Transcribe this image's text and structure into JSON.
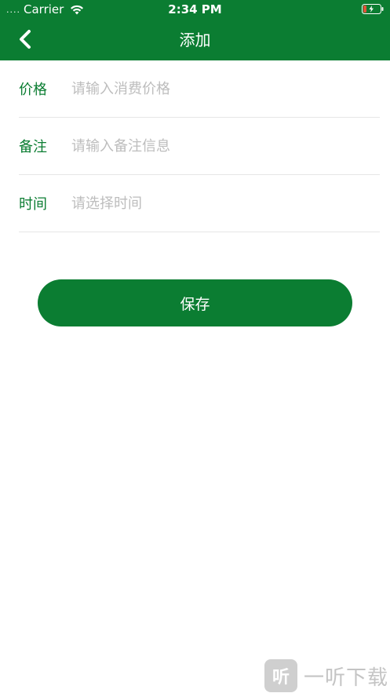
{
  "status_bar": {
    "signal": "....",
    "carrier": "Carrier",
    "time": "2:34 PM"
  },
  "nav": {
    "title": "添加",
    "back_icon": "chevron-left-icon"
  },
  "form": {
    "rows": [
      {
        "label": "价格",
        "placeholder": "请输入消费价格"
      },
      {
        "label": "备注",
        "placeholder": "请输入备注信息"
      },
      {
        "label": "时间",
        "placeholder": "请选择时间"
      }
    ]
  },
  "save_button": {
    "label": "保存"
  },
  "watermark": {
    "logo_text": "听",
    "text": "一听下载"
  },
  "colors": {
    "primary": "#0b7d32",
    "placeholder": "#bdbdbd",
    "divider": "#e6e6e6",
    "battery_low": "#e0533a"
  }
}
